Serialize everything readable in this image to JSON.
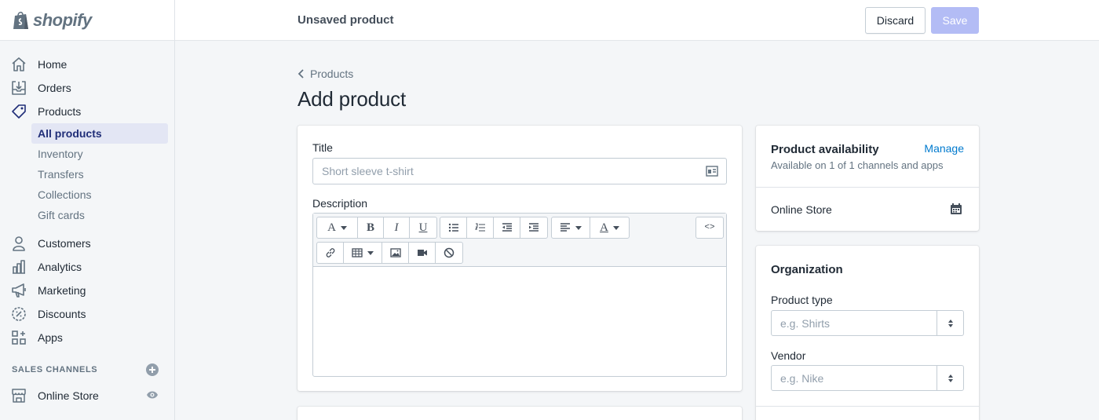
{
  "brand": {
    "name": "shopify",
    "logo_icon": "shopify-bag-icon",
    "color": "#637381"
  },
  "topbar": {
    "title": "Unsaved product",
    "discard_label": "Discard",
    "save_label": "Save"
  },
  "sidebar": {
    "items": [
      {
        "label": "Home",
        "icon": "home-icon"
      },
      {
        "label": "Orders",
        "icon": "orders-icon"
      },
      {
        "label": "Products",
        "icon": "tag-icon"
      }
    ],
    "product_subitems": [
      {
        "label": "All products",
        "active": true
      },
      {
        "label": "Inventory"
      },
      {
        "label": "Transfers"
      },
      {
        "label": "Collections"
      },
      {
        "label": "Gift cards"
      }
    ],
    "items2": [
      {
        "label": "Customers",
        "icon": "person-icon"
      },
      {
        "label": "Analytics",
        "icon": "bar-chart-icon"
      },
      {
        "label": "Marketing",
        "icon": "megaphone-icon"
      },
      {
        "label": "Discounts",
        "icon": "discount-icon"
      },
      {
        "label": "Apps",
        "icon": "apps-icon"
      }
    ],
    "sales_channels_title": "SALES CHANNELS",
    "online_store_label": "Online Store",
    "active_color": "#202e78"
  },
  "main": {
    "breadcrumb": "Products",
    "page_title": "Add product",
    "title_label": "Title",
    "title_placeholder": "Short sleeve t-shirt",
    "description_label": "Description"
  },
  "availability": {
    "title": "Product availability",
    "manage_label": "Manage",
    "subtitle": "Available on 1 of 1 channels and apps",
    "channel": "Online Store"
  },
  "organization": {
    "title": "Organization",
    "product_type_label": "Product type",
    "product_type_placeholder": "e.g. Shirts",
    "vendor_label": "Vendor",
    "vendor_placeholder": "e.g. Nike"
  },
  "colors": {
    "link": "#007ace",
    "save_disabled": "#b3bcf5",
    "background": "#f4f6f8"
  }
}
